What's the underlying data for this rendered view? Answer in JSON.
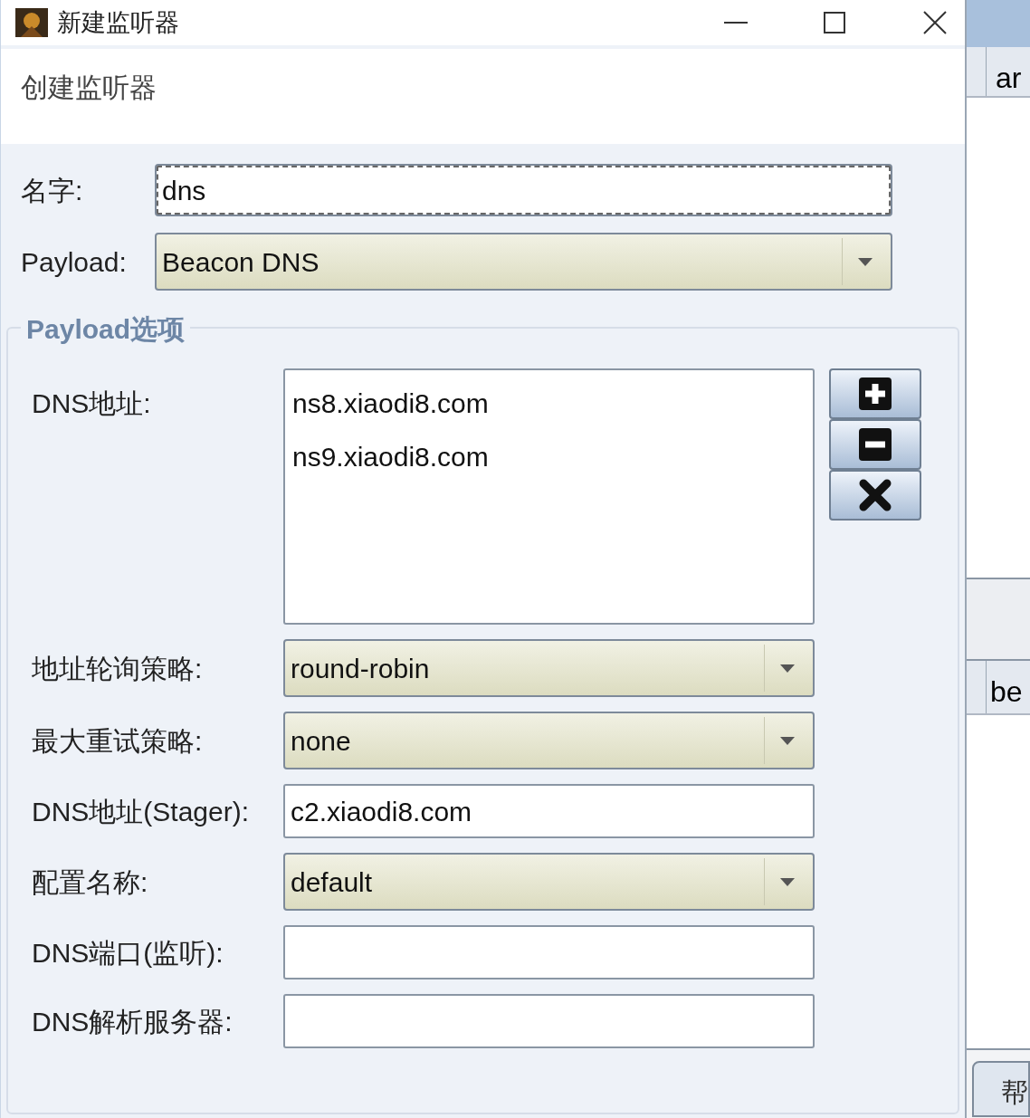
{
  "window": {
    "title": "新建监听器"
  },
  "header": "创建监听器",
  "fields": [
    {
      "label": "名字:",
      "kind": "text",
      "value": "dns",
      "focused": true
    },
    {
      "label": "Payload:",
      "kind": "select",
      "value": "Beacon DNS"
    }
  ],
  "payload_options": {
    "title": "Payload选项",
    "host_list": {
      "label": "DNS地址:",
      "items": [
        "ns8.xiaodi8.com",
        "ns9.xiaodi8.com"
      ],
      "buttons": [
        {
          "kind": "add"
        },
        {
          "kind": "remove"
        },
        {
          "kind": "clear"
        }
      ]
    },
    "fields": [
      {
        "label": "地址轮询策略:",
        "kind": "select",
        "value": "round-robin"
      },
      {
        "label": "最大重试策略:",
        "kind": "select",
        "value": "none"
      },
      {
        "label": "DNS地址(Stager):",
        "kind": "text",
        "value": "c2.xiaodi8.com"
      },
      {
        "label": "配置名称:",
        "kind": "select",
        "value": "default"
      },
      {
        "label": "DNS端口(监听):",
        "kind": "text"
      },
      {
        "label": "DNS解析服务器:",
        "kind": "text"
      }
    ]
  },
  "background": {
    "column_1": "ar",
    "column_2": "be",
    "button": "帮"
  }
}
